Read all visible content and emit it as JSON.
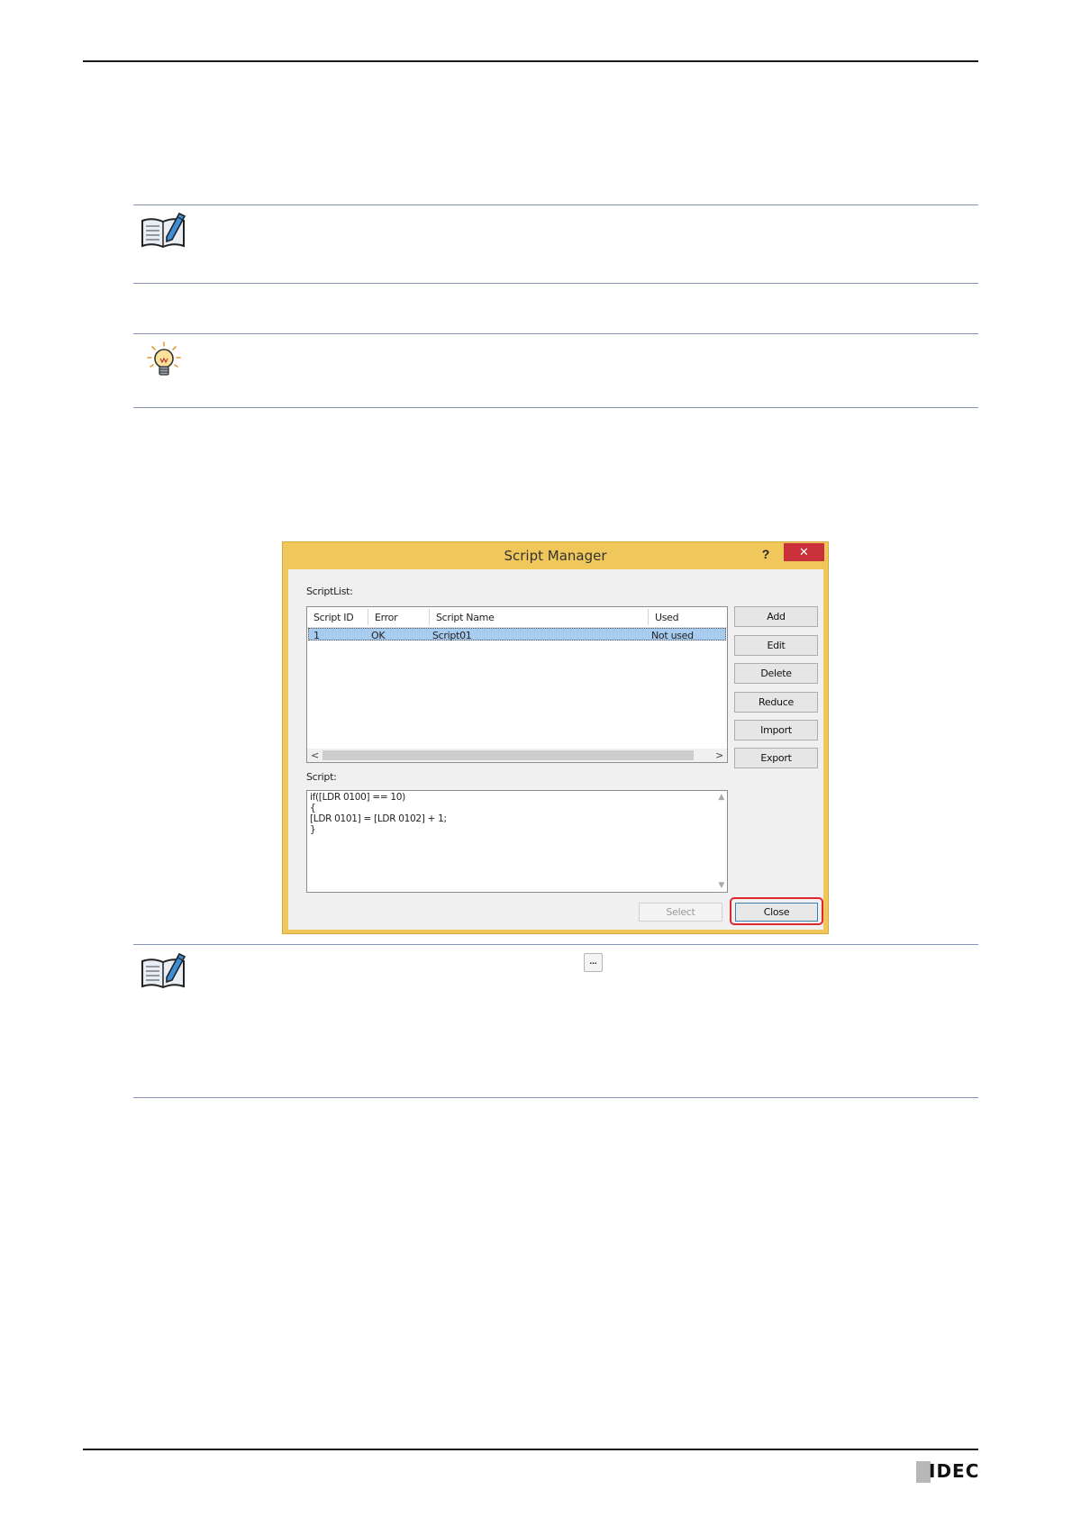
{
  "dialog": {
    "title": "Script Manager",
    "help_label": "?",
    "close_glyph": "✕",
    "scriptlist_label": "ScriptList:",
    "columns": [
      "Script ID",
      "Error",
      "Script Name",
      "Used"
    ],
    "rows": [
      {
        "id": "1",
        "error": "OK",
        "name": "Script01",
        "used": "Not used"
      }
    ],
    "scroll_left": "<",
    "scroll_right": ">",
    "buttons": {
      "add": "Add",
      "edit": "Edit",
      "delete": "Delete",
      "reduce": "Reduce",
      "import": "Import",
      "export": "Export",
      "select": "Select",
      "close": "Close"
    },
    "script_label": "Script:",
    "script_lines": [
      "if([LDR 0100] == 10)",
      "{",
      "[LDR 0101] = [LDR 0102] + 1;",
      "}"
    ]
  },
  "ellipsis_button": "...",
  "footer": {
    "logo": "IDEC"
  },
  "icons": {
    "note": "note-book-pencil-icon",
    "hint": "lightbulb-icon"
  }
}
